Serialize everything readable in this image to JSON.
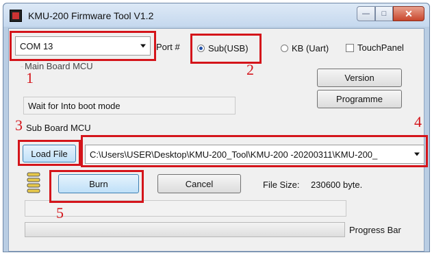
{
  "window": {
    "title": "KMU-200 Firmware Tool V1.2",
    "buttons": {
      "minimize_icon": "minimize-icon",
      "maximize_icon": "maximize-icon",
      "close_icon": "close-icon"
    }
  },
  "port": {
    "selected": "COM 13",
    "label": "Port #"
  },
  "mode": {
    "sub_usb": {
      "label": "Sub(USB)",
      "selected": true
    },
    "kb_uart": {
      "label": "KB (Uart)",
      "selected": false
    },
    "touch_panel": {
      "label": "TouchPanel",
      "checked": false
    }
  },
  "main_board": {
    "group_label": "Main Board MCU",
    "status": "Wait for Into boot mode",
    "version_button": "Version",
    "programme_button": "Programme"
  },
  "sub_board": {
    "group_label": "Sub Board MCU",
    "load_file_button": "Load File",
    "file_path": "C:\\Users\\USER\\Desktop\\KMU-200_Tool\\KMU-200 -20200311\\KMU-200_",
    "burn_button": "Burn",
    "cancel_button": "Cancel",
    "file_size_label": "File Size:",
    "file_size_value": "230600 byte.",
    "status_text": "",
    "progress_label": "Progress Bar",
    "progress": 0
  },
  "annotations": [
    "1",
    "2",
    "3",
    "4",
    "5"
  ],
  "colors": {
    "highlight": "#d4141a",
    "accent": "#3c7fb1"
  }
}
